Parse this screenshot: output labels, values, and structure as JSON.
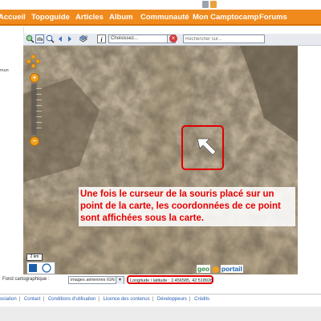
{
  "nav": {
    "items": [
      "Accueil",
      "Topoguide",
      "Articles",
      "Album",
      "Communauté",
      "Mon Camptocamp",
      "Forums"
    ]
  },
  "sidebar": {
    "fragment": "mun"
  },
  "toolbar": {
    "select_value": "Choisissez...",
    "search_placeholder": "Rechercher sur...",
    "layers_count": "2",
    "icons": [
      "zoom-box-icon",
      "pan-hand-icon",
      "zoom-in-icon",
      "previous-icon",
      "next-icon",
      "layers-icon",
      "info-icon",
      "clear-icon"
    ]
  },
  "map": {
    "annotation": "Une fois le curseur de la souris placé sur un point de la carte, les coordonnées de ce point sont affichées sous la carte.",
    "scale_label": "2 km",
    "logo_geo": "geo",
    "logo_portail": "portail",
    "accent_red": "#e00000",
    "nav_orange": "#f08a1c"
  },
  "bottom_bar": {
    "layer_label": "Fond cartographique :",
    "layer_value": "images aériennes IGN",
    "coords_label": "Longitude / latitude :",
    "coords_value": "2.456585, 42.518928"
  },
  "footer": {
    "links": [
      "ociation",
      "Contact",
      "Conditions d'utilisation",
      "Licence des contenus",
      "Développeurs",
      "Crédits"
    ]
  }
}
